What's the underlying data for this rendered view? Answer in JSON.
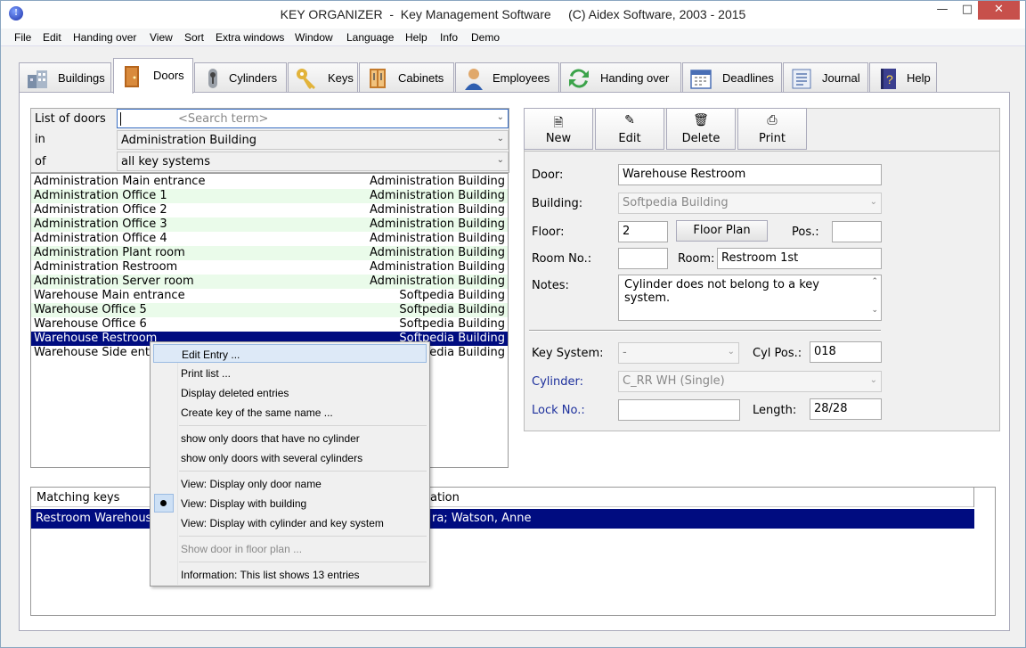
{
  "window": {
    "title": "KEY ORGANIZER  -  Key Management Software     (C) Aidex Software, 2003 - 2015"
  },
  "menu": [
    "File",
    "Edit",
    "Handing over",
    "View",
    "Sort",
    "Extra windows",
    "Window",
    "Language",
    "Help",
    "Info",
    "Demo"
  ],
  "tabs": [
    {
      "label": "Buildings",
      "icon": "buildings-icon"
    },
    {
      "label": "Doors",
      "icon": "door-icon"
    },
    {
      "label": "Cylinders",
      "icon": "cylinder-icon"
    },
    {
      "label": "Keys",
      "icon": "key-icon"
    },
    {
      "label": "Cabinets",
      "icon": "cabinet-icon"
    },
    {
      "label": "Employees",
      "icon": "employee-icon"
    },
    {
      "label": "Handing over",
      "icon": "handing-over-icon"
    },
    {
      "label": "Deadlines",
      "icon": "calendar-icon"
    },
    {
      "label": "Journal",
      "icon": "journal-icon"
    },
    {
      "label": "Help",
      "icon": "help-book-icon"
    }
  ],
  "filters": {
    "list_label": "List of doors",
    "search_placeholder": "<Search term>",
    "in_label": "in",
    "in_value": "Administration Building",
    "of_label": "of",
    "of_value": "all key systems"
  },
  "doors": [
    {
      "name": "Administration Main entrance",
      "building": "Administration Building"
    },
    {
      "name": "Administration Office 1",
      "building": "Administration Building"
    },
    {
      "name": "Administration Office 2",
      "building": "Administration Building"
    },
    {
      "name": "Administration Office 3",
      "building": "Administration Building"
    },
    {
      "name": "Administration Office 4",
      "building": "Administration Building"
    },
    {
      "name": "Administration Plant room",
      "building": "Administration Building"
    },
    {
      "name": "Administration Restroom",
      "building": "Administration Building"
    },
    {
      "name": "Administration Server room",
      "building": "Administration Building"
    },
    {
      "name": "Warehouse Main entrance",
      "building": "Softpedia Building"
    },
    {
      "name": "Warehouse Office 5",
      "building": "Softpedia Building"
    },
    {
      "name": "Warehouse Office 6",
      "building": "Softpedia Building"
    },
    {
      "name": "Warehouse Restroom",
      "building": "Softpedia Building"
    },
    {
      "name": "Warehouse Side ent",
      "building": "Softpedia Building"
    }
  ],
  "toolbar": {
    "new": "New",
    "edit": "Edit",
    "delete": "Delete",
    "print": "Print"
  },
  "form": {
    "door_label": "Door:",
    "door": "Warehouse Restroom",
    "building_label": "Building:",
    "building": "Softpedia Building",
    "floor_label": "Floor:",
    "floor": "2",
    "floor_plan": "Floor Plan",
    "pos_label": "Pos.:",
    "pos": "",
    "roomno_label": "Room No.:",
    "roomno": "",
    "room_label": "Room:",
    "room": "Restroom 1st",
    "notes_label": "Notes:",
    "notes_line1": "Cylinder does not belong to a key",
    "notes_line2": "system.",
    "keysystem_label": "Key System:",
    "keysystem": "-",
    "cylpos_label": "Cyl Pos.:",
    "cylpos": "018",
    "cylinder_label": "Cylinder:",
    "cylinder": "C_RR WH (Single)",
    "lockno_label": "Lock No.:",
    "lockno": "",
    "length_label": "Length:",
    "length": "28/28"
  },
  "matching": {
    "col1": "Matching keys",
    "col2": "ation",
    "row_left": "Restroom Warehous",
    "row_right": "ra; Watson, Anne"
  },
  "context_menu": [
    "Edit Entry ...",
    "Print list ...",
    "Display deleted entries",
    "Create key of the same name ...",
    "show only doors that have no cylinder",
    "show only doors with several cylinders",
    "View: Display only door name",
    "View: Display with building",
    "View: Display with cylinder and key system",
    "Show door in floor plan ...",
    "Information: This list shows 13 entries"
  ],
  "colors": {
    "selection": "#000c80",
    "alt_row": "#eafbea",
    "label_blue": "#1c2f9c",
    "close": "#c7504b"
  }
}
